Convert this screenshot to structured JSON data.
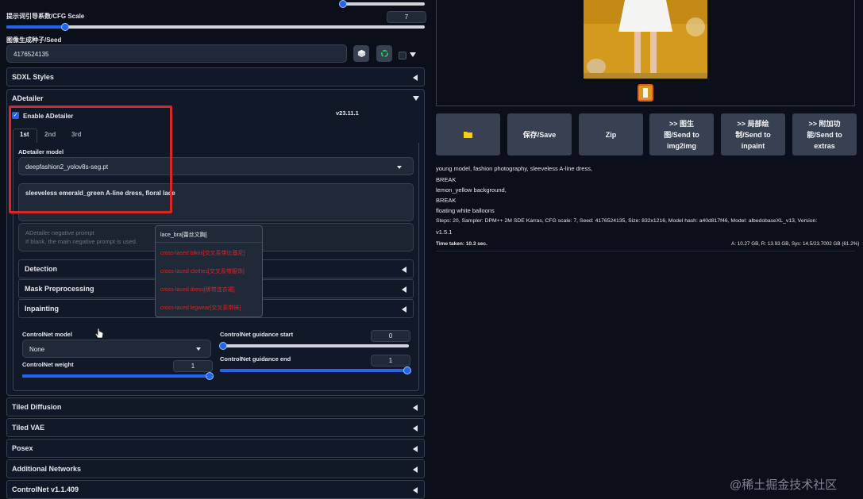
{
  "cfg": {
    "label": "提示词引导系数/CFG Scale",
    "value": "7",
    "fraction": 0.14
  },
  "seed": {
    "label": "图像生成种子/Seed",
    "value": "4176524135"
  },
  "sections": {
    "sdxl_styles": "SDXL Styles",
    "adetailer": "ADetailer",
    "detection": "Detection",
    "mask_preprocessing": "Mask Preprocessing",
    "inpainting": "Inpainting",
    "tiled_diffusion": "Tiled Diffusion",
    "tiled_vae": "Tiled VAE",
    "posex": "Posex",
    "additional_networks": "Additional Networks",
    "controlnet": "ControlNet v1.1.409"
  },
  "adetailer": {
    "enable_label": "Enable ADetailer",
    "version": "v23.11.1",
    "tabs": [
      "1st",
      "2nd",
      "3rd"
    ],
    "model_label": "ADetailer model",
    "model_value": "deepfashion2_yolov8s-seg.pt",
    "prompt_value": "sleeveless emerald_green A-line dress, floral lace",
    "neg_placeholder_line1": "ADetailer negative prompt",
    "neg_placeholder_line2": "If blank, the main negative prompt is used."
  },
  "autocomplete": {
    "items": [
      {
        "text": "lace_bra[蕾丝文胸]",
        "color": "#e5e7eb"
      },
      {
        "text": "cross-laced bikini[交叉系带比基尼]",
        "color": "#dc2626"
      },
      {
        "text": "cross-laced clothes[交叉系带服饰]",
        "color": "#dc2626"
      },
      {
        "text": "cross-laced dress[绑带连衣裙]",
        "color": "#dc2626"
      },
      {
        "text": "cross-laced legwear[交叉系带袜]",
        "color": "#dc2626"
      }
    ]
  },
  "controlnet_ui": {
    "model_label": "ControlNet model",
    "model_value": "None",
    "weight_label": "ControlNet weight",
    "weight_value": "1",
    "weight_fraction": 1.0,
    "start_label": "ControlNet guidance start",
    "start_value": "0",
    "start_fraction": 0.0,
    "end_label": "ControlNet guidance end",
    "end_value": "1",
    "end_fraction": 1.0
  },
  "actions": {
    "save": "保存/Save",
    "zip": "Zip",
    "img2img": ">> 图生\n图/Send to\nimg2img",
    "inpaint": ">> 局部绘\n制/Send to\ninpaint",
    "extras": ">> 附加功\n能/Send to\nextras"
  },
  "generation_info": {
    "lines": [
      "young model, fashion photography, sleeveless A-line dress,",
      "BREAK",
      "lemon_yellow background,",
      "BREAK",
      "floating white balloons",
      "Steps: 20, Sampler: DPM++ 2M SDE Karras, CFG scale: 7, Seed: 4176524135, Size: 832x1216, Model hash: a40d817f46, Model: albedobaseXL_v13, Version:",
      "v1.5.1"
    ],
    "time_taken": "Time taken: 10.3 sec.",
    "vram": "A: 10.27 GB, R: 13.93 GB, Sys: 14.5/23.7002 GB (61.2%)"
  },
  "watermark": "@稀土掘金技术社区",
  "colors": {
    "accent": "#2563eb",
    "highlight_box": "#dc2626",
    "background": "#0b0f19"
  }
}
